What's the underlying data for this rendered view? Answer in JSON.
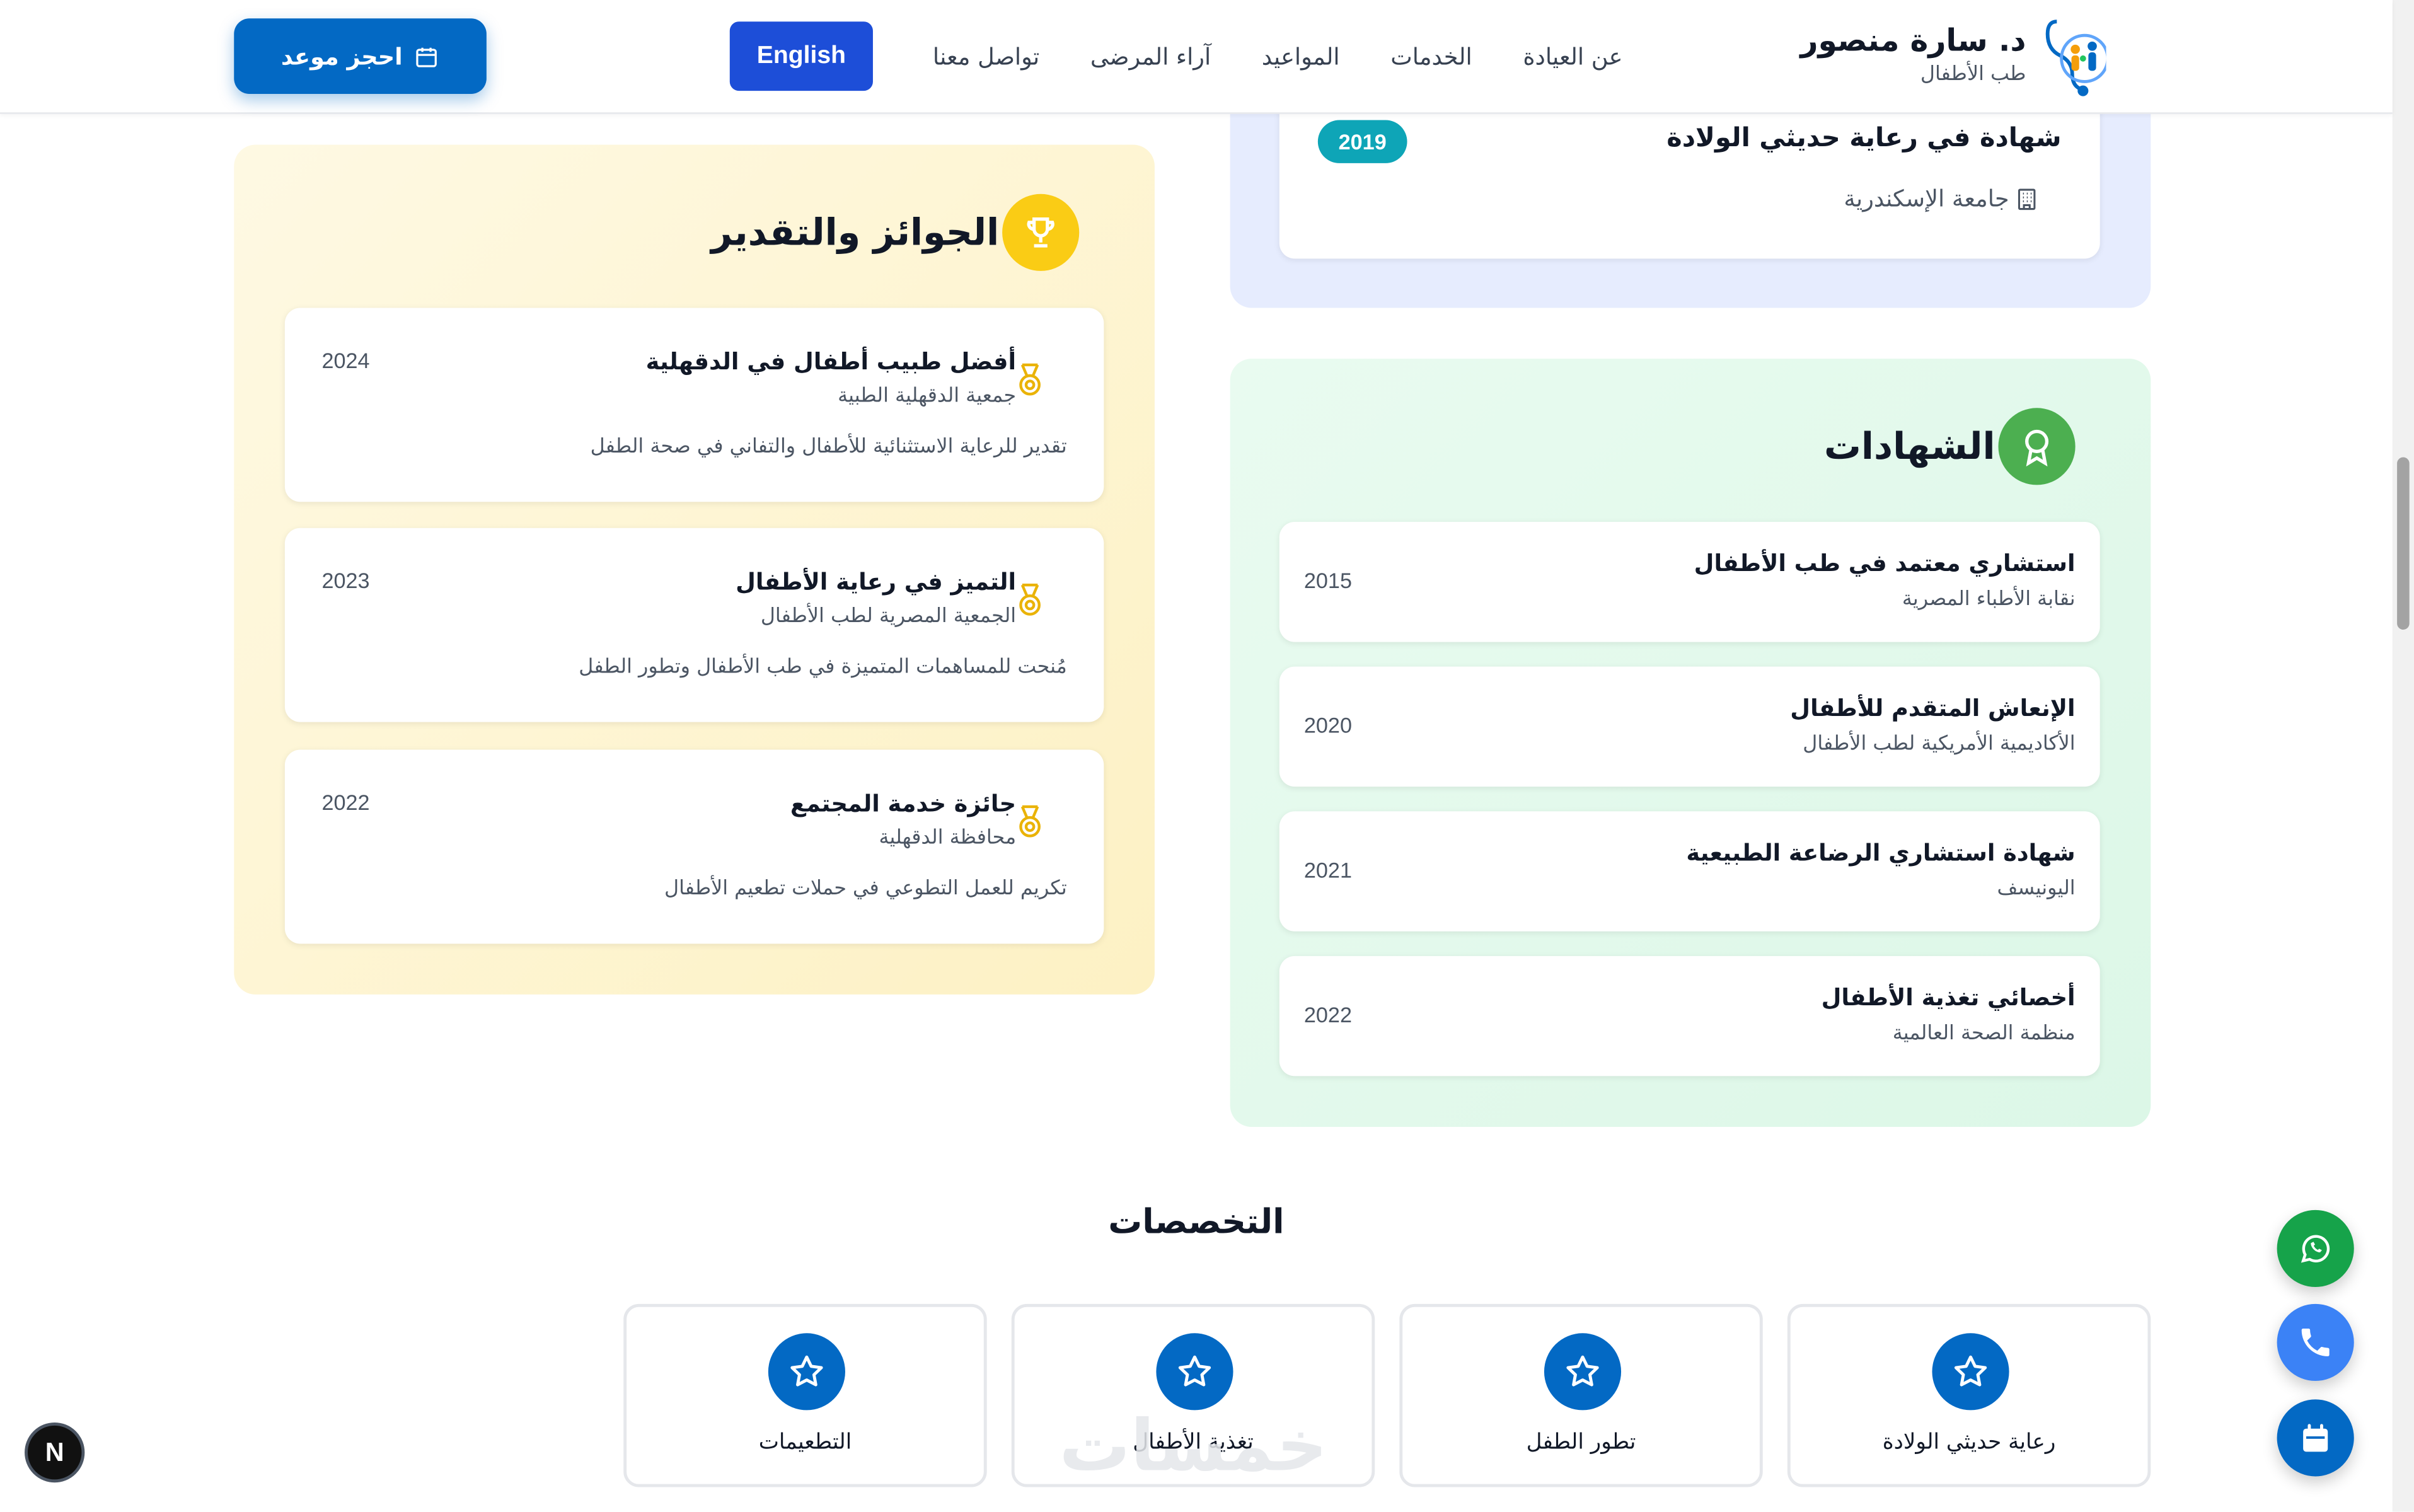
{
  "header": {
    "brand_name": "د. سارة منصور",
    "brand_subtitle": "طب الأطفال",
    "nav": [
      "عن العيادة",
      "الخدمات",
      "المواعيد",
      "آراء المرضى",
      "تواصل معنا"
    ],
    "lang_button": "English",
    "book_button": "احجز موعد"
  },
  "education": {
    "title": "شهادة في رعاية حديثي الولادة",
    "institution": "جامعة الإسكندرية",
    "year": "2019"
  },
  "awards": {
    "title": "الجوائز والتقدير",
    "items": [
      {
        "title": "أفضل طبيب أطفال في الدقهلية",
        "org": "جمعية الدقهلية الطبية",
        "desc": "تقدير للرعاية الاستثنائية للأطفال والتفاني في صحة الطفل",
        "year": "2024"
      },
      {
        "title": "التميز في رعاية الأطفال",
        "org": "الجمعية المصرية لطب الأطفال",
        "desc": "مُنحت للمساهمات المتميزة في طب الأطفال وتطور الطفل",
        "year": "2023"
      },
      {
        "title": "جائزة خدمة المجتمع",
        "org": "محافظة الدقهلية",
        "desc": "تكريم للعمل التطوعي في حملات تطعيم الأطفال",
        "year": "2022"
      }
    ]
  },
  "certificates": {
    "title": "الشهادات",
    "items": [
      {
        "title": "استشاري معتمد في طب الأطفال",
        "org": "نقابة الأطباء المصرية",
        "year": "2015"
      },
      {
        "title": "الإنعاش المتقدم للأطفال",
        "org": "الأكاديمية الأمريكية لطب الأطفال",
        "year": "2020"
      },
      {
        "title": "شهادة استشاري الرضاعة الطبيعية",
        "org": "اليونيسف",
        "year": "2021"
      },
      {
        "title": "أخصائي تغذية الأطفال",
        "org": "منظمة الصحة العالمية",
        "year": "2022"
      }
    ]
  },
  "specialties": {
    "title": "التخصصات",
    "items": [
      "رعاية حديثي الولادة",
      "تطور الطفل",
      "تغذية الأطفال",
      "التطعيمات"
    ]
  },
  "watermark": "خمسات",
  "next_badge": "N",
  "icons": {
    "brand": "stethoscope-family-icon",
    "book": "calendar-icon",
    "awards_head": "trophy-icon",
    "award_item": "medal-icon",
    "cert_head": "award-ribbon-icon",
    "institution": "building-icon",
    "specialty": "star-icon",
    "whatsapp": "whatsapp-icon",
    "phone": "phone-icon",
    "calendar_fab": "calendar-icon"
  },
  "colors": {
    "primary": "#0369c4",
    "lang_button": "#1d4ed8",
    "awards_bg": "#fdf1c4",
    "cert_bg": "#dcf7e7",
    "edu_bg": "#e6ecfe",
    "trophy": "#facc15",
    "cert_icon": "#4caf50",
    "badge": "#0ea5b7",
    "whatsapp": "#16a34a",
    "phone": "#3b82f6"
  }
}
